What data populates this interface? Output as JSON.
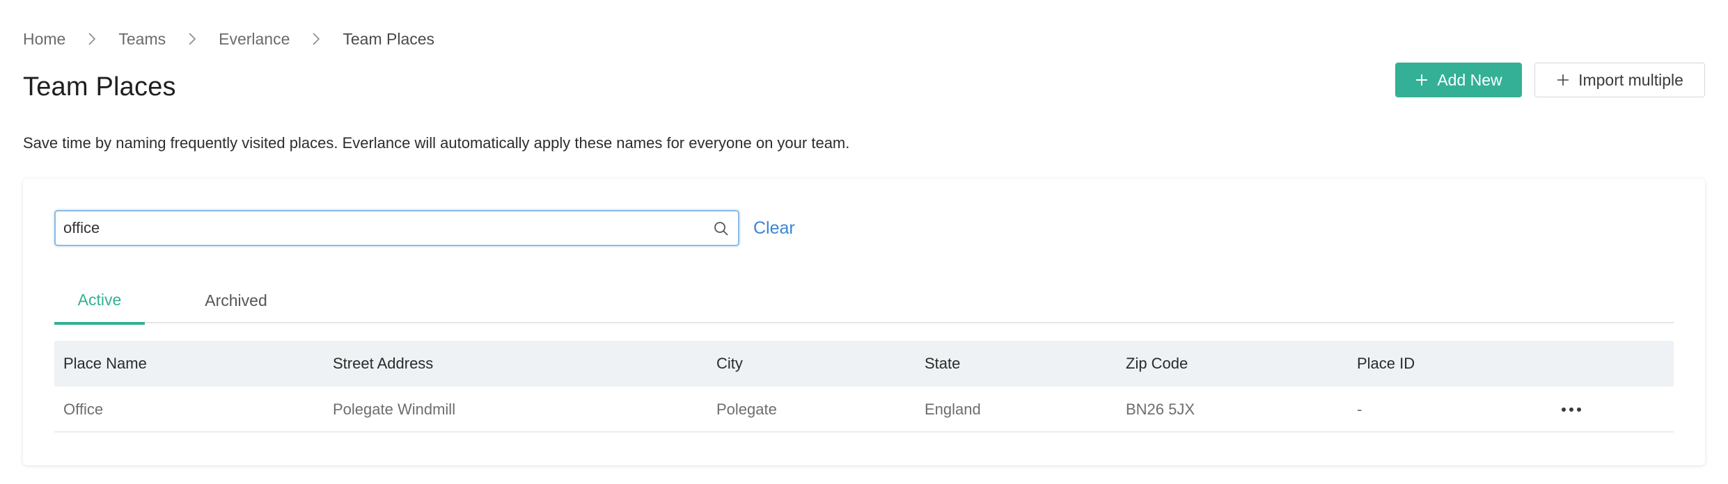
{
  "breadcrumb": {
    "items": [
      "Home",
      "Teams",
      "Everlance",
      "Team Places"
    ]
  },
  "page": {
    "title": "Team Places",
    "description": "Save time by naming frequently visited places. Everlance will automatically apply these names for everyone on your team."
  },
  "actions": {
    "add_new": "Add New",
    "import_multiple": "Import multiple"
  },
  "search": {
    "value": "office",
    "clear_label": "Clear"
  },
  "tabs": [
    {
      "label": "Active",
      "selected": true
    },
    {
      "label": "Archived",
      "selected": false
    }
  ],
  "table": {
    "columns": [
      "Place Name",
      "Street Address",
      "City",
      "State",
      "Zip Code",
      "Place ID"
    ],
    "rows": [
      [
        "Office",
        "Polegate Windmill",
        "Polegate",
        "England",
        "BN26 5JX",
        "-"
      ]
    ]
  },
  "colors": {
    "accent": "#33b095",
    "link": "#3a86d3",
    "header_bg": "#eef2f4"
  },
  "icons": {
    "breadcrumb_separator": "chevron-right-icon",
    "add": "plus-icon",
    "search": "search-icon",
    "row_menu": "more-horizontal-icon"
  }
}
